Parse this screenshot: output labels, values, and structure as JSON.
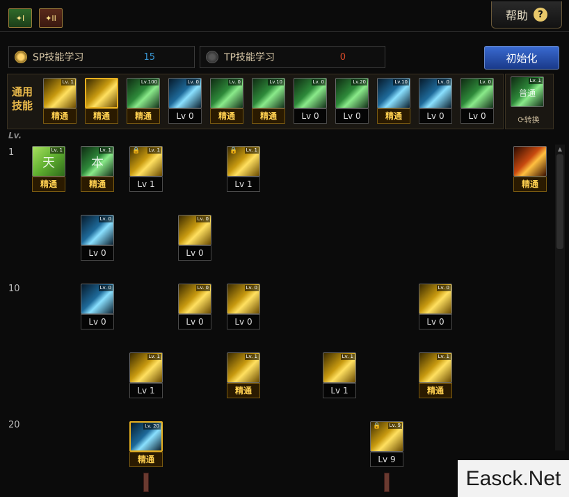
{
  "tabs": [
    {
      "icon": "skill-tree-1-icon",
      "label": "I"
    },
    {
      "icon": "skill-tree-2-icon",
      "label": "II"
    }
  ],
  "help": {
    "label": "帮助",
    "icon_text": "?"
  },
  "sp": {
    "label": "SP技能学习",
    "value": "15",
    "value_color": "#3a9ad8"
  },
  "tp": {
    "label": "TP技能学习",
    "value": "0",
    "value_color": "#d84a2a"
  },
  "reset_label": "初始化",
  "common": {
    "label": "通用技能",
    "skills": [
      {
        "icon": "kick-skill-icon",
        "tag": "Lv. 1",
        "lv": "精通",
        "mastery": true
      },
      {
        "icon": "backstep-skill-icon",
        "tag": "",
        "lv": "精通",
        "mastery": true
      },
      {
        "icon": "leap-skill-icon",
        "tag": "Lv.100",
        "lv": "精通",
        "mastery": true
      },
      {
        "icon": "wings-skill-icon",
        "tag": "Lv. 0",
        "lv": "Lv 0",
        "mastery": false
      },
      {
        "icon": "target-skill-icon",
        "tag": "Lv. 0",
        "lv": "精通",
        "mastery": true
      },
      {
        "icon": "target2-skill-icon",
        "tag": "Lv.10",
        "lv": "精通",
        "mastery": true
      },
      {
        "icon": "fighter-skill-icon",
        "tag": "Lv. 0",
        "lv": "Lv 0",
        "mastery": false
      },
      {
        "icon": "fighter2-skill-icon",
        "tag": "Lv.20",
        "lv": "Lv 0",
        "mastery": false
      },
      {
        "icon": "eye-skill-icon",
        "tag": "Lv.10",
        "lv": "精通",
        "mastery": true
      },
      {
        "icon": "body-skill-icon",
        "tag": "Lv. 0",
        "lv": "Lv 0",
        "mastery": false
      },
      {
        "icon": "dash-skill-icon",
        "tag": "Lv. 0",
        "lv": "Lv 0",
        "mastery": false
      }
    ],
    "switch": {
      "icon": "normal-skill-icon",
      "icon_text": "普通",
      "tag": "Lv. 1",
      "label": "转换"
    }
  },
  "tree": {
    "lv_header": "Lv.",
    "rows": [
      "1",
      "10",
      "20"
    ],
    "skills": [
      {
        "icon": "heaven-skill-icon",
        "text": "天",
        "color": "l",
        "tag": "Lv. 1",
        "lv": "精通",
        "mastery": true,
        "lock": false
      },
      {
        "icon": "book-skill-icon",
        "text": "本",
        "color": "g",
        "tag": "Lv. 1",
        "lv": "精通",
        "mastery": true,
        "lock": false
      },
      {
        "icon": "slash-skill-icon",
        "text": "",
        "color": "y",
        "tag": "Lv. 1",
        "lv": "Lv 1",
        "mastery": false,
        "lock": true
      },
      {
        "icon": "crescent-skill-icon",
        "text": "",
        "color": "y",
        "tag": "Lv. 1",
        "lv": "Lv 1",
        "mastery": false,
        "lock": true
      },
      {
        "icon": "flame-skill-icon",
        "text": "",
        "color": "o",
        "tag": "",
        "lv": "精通",
        "mastery": true,
        "lock": false
      },
      {
        "icon": "hand-skill-icon",
        "text": "",
        "color": "c",
        "tag": "Lv. 0",
        "lv": "Lv 0",
        "mastery": false,
        "lock": false
      },
      {
        "icon": "burst-skill-icon",
        "text": "",
        "color": "y",
        "tag": "Lv. 0",
        "lv": "Lv 0",
        "mastery": false,
        "lock": false
      },
      {
        "icon": "cross-skill-icon",
        "text": "",
        "color": "c",
        "tag": "Lv. 0",
        "lv": "Lv 0",
        "mastery": false,
        "lock": false
      },
      {
        "icon": "claw-skill-icon",
        "text": "",
        "color": "y",
        "tag": "Lv. 0",
        "lv": "Lv 0",
        "mastery": false,
        "lock": false
      },
      {
        "icon": "swirl-skill-icon",
        "text": "",
        "color": "y",
        "tag": "Lv. 0",
        "lv": "Lv 0",
        "mastery": false,
        "lock": false
      },
      {
        "icon": "warrior-skill-icon",
        "text": "",
        "color": "y",
        "tag": "Lv. 0",
        "lv": "Lv 0",
        "mastery": false,
        "lock": false
      },
      {
        "icon": "explosion-skill-icon",
        "text": "",
        "color": "y",
        "tag": "Lv. 1",
        "lv": "Lv 1",
        "mastery": false,
        "lock": false
      },
      {
        "icon": "beam-skill-icon",
        "text": "",
        "color": "y",
        "tag": "Lv. 1",
        "lv": "精通",
        "mastery": true,
        "lock": false
      },
      {
        "icon": "fist-skill-icon",
        "text": "",
        "color": "y",
        "tag": "Lv. 1",
        "lv": "Lv 1",
        "mastery": false,
        "lock": false
      },
      {
        "icon": "aura-skill-icon",
        "text": "",
        "color": "y",
        "tag": "Lv. 1",
        "lv": "精通",
        "mastery": true,
        "lock": false
      },
      {
        "icon": "water-skill-icon",
        "text": "",
        "color": "c",
        "tag": "Lv. 20",
        "lv": "精通",
        "mastery": true,
        "lock": false
      },
      {
        "icon": "scroll-skill-icon",
        "text": "",
        "color": "y",
        "tag": "Lv. 9",
        "lv": "Lv 9",
        "mastery": false,
        "lock": true
      }
    ]
  },
  "watermark": "Easck.Net"
}
